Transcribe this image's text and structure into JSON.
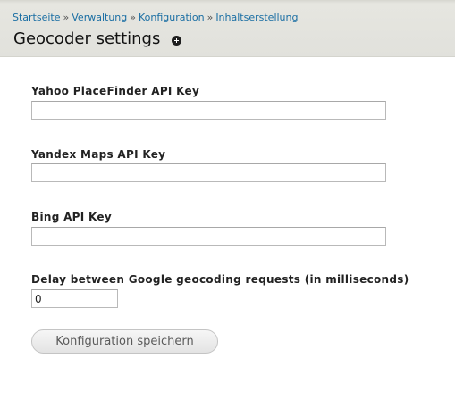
{
  "breadcrumb": {
    "items": [
      "Startseite",
      "Verwaltung",
      "Konfiguration",
      "Inhaltserstellung"
    ],
    "separator": "»"
  },
  "page": {
    "title": "Geocoder settings"
  },
  "form": {
    "yahoo": {
      "label": "Yahoo PlaceFinder API Key",
      "value": ""
    },
    "yandex": {
      "label": "Yandex Maps API Key",
      "value": ""
    },
    "bing": {
      "label": "Bing API Key",
      "value": ""
    },
    "delay": {
      "label": "Delay between Google geocoding requests (in milliseconds)",
      "value": "0"
    },
    "submit_label": "Konfiguration speichern"
  },
  "colors": {
    "link": "#1a6ea3",
    "header_bg": "#e1e1dc"
  }
}
